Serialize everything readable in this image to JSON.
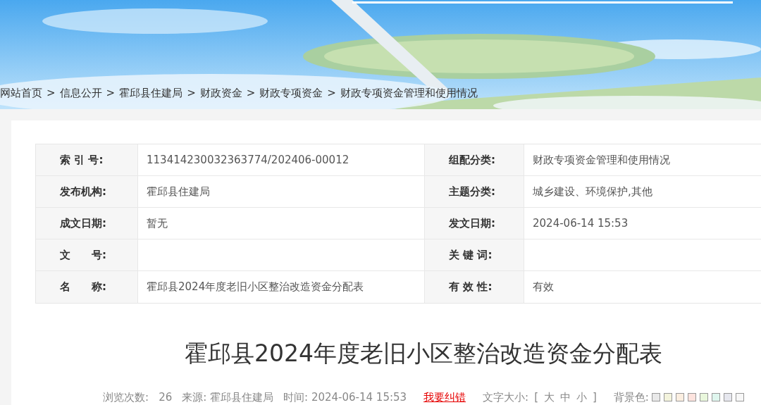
{
  "breadcrumb": [
    {
      "text": "网站首页"
    },
    {
      "sep": ">",
      "text": "信息公开"
    },
    {
      "sep": ">",
      "text": "霍邱县住建局"
    },
    {
      "sep": ">",
      "text": "财政资金"
    },
    {
      "sep": ">",
      "text": "财政专项资金"
    },
    {
      "sep": ">",
      "text": "财政专项资金管理和使用情况"
    }
  ],
  "meta_table": [
    [
      {
        "label": "索 引 号:",
        "value": "113414230032363774/202406-00012"
      },
      {
        "label": "组配分类:",
        "value": "财政专项资金管理和使用情况"
      }
    ],
    [
      {
        "label": "发布机构:",
        "value": "霍邱县住建局"
      },
      {
        "label": "主题分类:",
        "value": "城乡建设、环境保护,其他"
      }
    ],
    [
      {
        "label": "成文日期:",
        "value": "暂无"
      },
      {
        "label": "发文日期:",
        "value": "2024-06-14 15:53"
      }
    ],
    [
      {
        "label": "文　　号:"
      },
      {
        "label": "关 键 词:"
      }
    ],
    [
      {
        "label": "名　　称:",
        "value": "霍邱县2024年度老旧小区整治改造资金分配表"
      },
      {
        "label": "有 效 性:",
        "value": "有效"
      }
    ]
  ],
  "title": "霍邱县2024年度老旧小区整治改造资金分配表",
  "info_bar": {
    "views_label": "浏览次数:",
    "views": "26",
    "source_label": "来源:",
    "source": "霍邱县住建局",
    "time_label": "时间:",
    "time": "2024-06-14 15:53",
    "report_link": "我要纠错",
    "font_size_label": "文字大小:",
    "bracket_open": "[",
    "font_sizes": [
      "大",
      "中",
      "小"
    ],
    "bracket_close": "]",
    "bg_label": "背景色:",
    "bg_swatches": [
      {
        "color": "#e9e9e9"
      },
      {
        "color": "#f3f3dc"
      },
      {
        "color": "#fbeee0"
      },
      {
        "color": "#fde3de"
      },
      {
        "color": "#e9f7dc"
      },
      {
        "color": "#dff6ee"
      },
      {
        "color": "#e6e7ee"
      },
      {
        "color": "#f7f7f7"
      }
    ]
  }
}
